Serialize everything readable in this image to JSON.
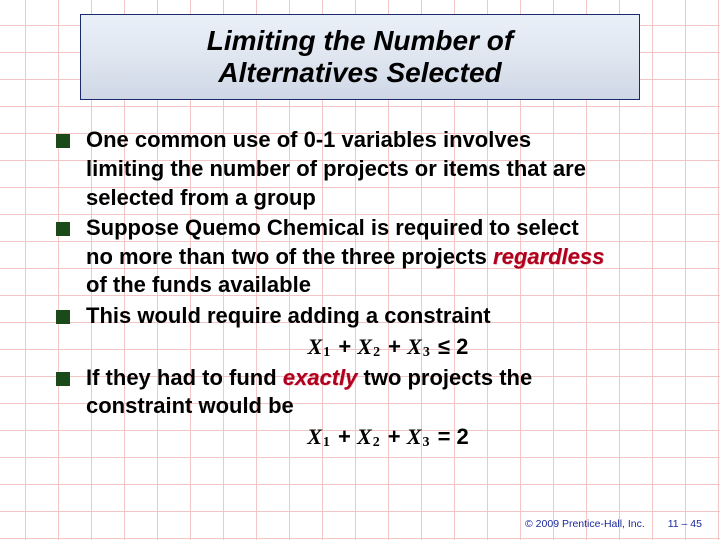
{
  "title": {
    "line1": "Limiting the Number of",
    "line2": "Alternatives Selected"
  },
  "bullets": {
    "b1a": "One common use of 0-1 variables involves",
    "b1b": "limiting the number of projects or items that are",
    "b1c": "selected from a group",
    "b2a": "Suppose Quemo Chemical is required to select",
    "b2b_pre": "no more than two of the three projects ",
    "b2b_em": "regardless",
    "b2c": "of the funds available",
    "b3": "This would require adding a constraint",
    "b4a": "If they had to fund ",
    "b4em": "exactly",
    "b4b": " two projects the",
    "b4c": "constraint would be"
  },
  "formulas": {
    "f1": {
      "x": "X",
      "s1": "1",
      "plus": " + ",
      "s2": "2",
      "s3": "3",
      "rel": " ≤ 2"
    },
    "f2": {
      "x": "X",
      "s1": "1",
      "plus": " + ",
      "s2": "2",
      "s3": "3",
      "rel": " = 2"
    }
  },
  "footer": {
    "copyright": "© 2009 Prentice-Hall, Inc.",
    "pg": "11 – 45"
  }
}
